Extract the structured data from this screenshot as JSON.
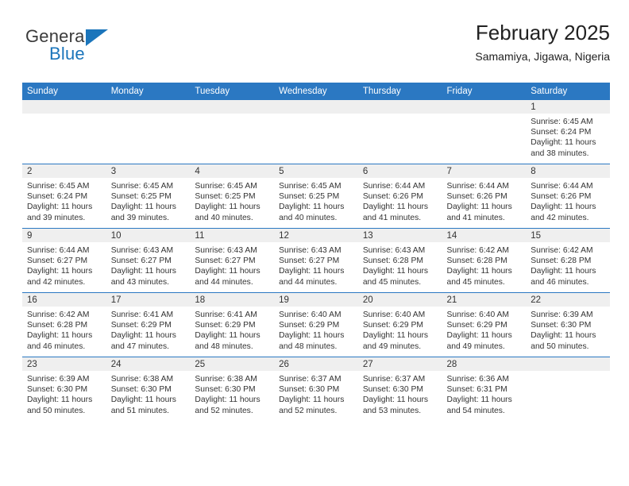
{
  "brand": {
    "name_top": "General",
    "name_bottom": "Blue",
    "accent_color": "#1b75bb"
  },
  "header": {
    "title": "February 2025",
    "subtitle": "Samamiya, Jigawa, Nigeria"
  },
  "theme": {
    "header_blue": "#2b78c2",
    "daynum_band": "#efefef",
    "text": "#333333"
  },
  "calendar": {
    "weekday_headers": [
      "Sunday",
      "Monday",
      "Tuesday",
      "Wednesday",
      "Thursday",
      "Friday",
      "Saturday"
    ],
    "labels": {
      "sunrise": "Sunrise:",
      "sunset": "Sunset:",
      "daylight": "Daylight:"
    },
    "weeks": [
      [
        {
          "day": "",
          "empty": true
        },
        {
          "day": "",
          "empty": true
        },
        {
          "day": "",
          "empty": true
        },
        {
          "day": "",
          "empty": true
        },
        {
          "day": "",
          "empty": true
        },
        {
          "day": "",
          "empty": true
        },
        {
          "day": "1",
          "sunrise": "Sunrise: 6:45 AM",
          "sunset": "Sunset: 6:24 PM",
          "daylight": "Daylight: 11 hours and 38 minutes."
        }
      ],
      [
        {
          "day": "2",
          "sunrise": "Sunrise: 6:45 AM",
          "sunset": "Sunset: 6:24 PM",
          "daylight": "Daylight: 11 hours and 39 minutes."
        },
        {
          "day": "3",
          "sunrise": "Sunrise: 6:45 AM",
          "sunset": "Sunset: 6:25 PM",
          "daylight": "Daylight: 11 hours and 39 minutes."
        },
        {
          "day": "4",
          "sunrise": "Sunrise: 6:45 AM",
          "sunset": "Sunset: 6:25 PM",
          "daylight": "Daylight: 11 hours and 40 minutes."
        },
        {
          "day": "5",
          "sunrise": "Sunrise: 6:45 AM",
          "sunset": "Sunset: 6:25 PM",
          "daylight": "Daylight: 11 hours and 40 minutes."
        },
        {
          "day": "6",
          "sunrise": "Sunrise: 6:44 AM",
          "sunset": "Sunset: 6:26 PM",
          "daylight": "Daylight: 11 hours and 41 minutes."
        },
        {
          "day": "7",
          "sunrise": "Sunrise: 6:44 AM",
          "sunset": "Sunset: 6:26 PM",
          "daylight": "Daylight: 11 hours and 41 minutes."
        },
        {
          "day": "8",
          "sunrise": "Sunrise: 6:44 AM",
          "sunset": "Sunset: 6:26 PM",
          "daylight": "Daylight: 11 hours and 42 minutes."
        }
      ],
      [
        {
          "day": "9",
          "sunrise": "Sunrise: 6:44 AM",
          "sunset": "Sunset: 6:27 PM",
          "daylight": "Daylight: 11 hours and 42 minutes."
        },
        {
          "day": "10",
          "sunrise": "Sunrise: 6:43 AM",
          "sunset": "Sunset: 6:27 PM",
          "daylight": "Daylight: 11 hours and 43 minutes."
        },
        {
          "day": "11",
          "sunrise": "Sunrise: 6:43 AM",
          "sunset": "Sunset: 6:27 PM",
          "daylight": "Daylight: 11 hours and 44 minutes."
        },
        {
          "day": "12",
          "sunrise": "Sunrise: 6:43 AM",
          "sunset": "Sunset: 6:27 PM",
          "daylight": "Daylight: 11 hours and 44 minutes."
        },
        {
          "day": "13",
          "sunrise": "Sunrise: 6:43 AM",
          "sunset": "Sunset: 6:28 PM",
          "daylight": "Daylight: 11 hours and 45 minutes."
        },
        {
          "day": "14",
          "sunrise": "Sunrise: 6:42 AM",
          "sunset": "Sunset: 6:28 PM",
          "daylight": "Daylight: 11 hours and 45 minutes."
        },
        {
          "day": "15",
          "sunrise": "Sunrise: 6:42 AM",
          "sunset": "Sunset: 6:28 PM",
          "daylight": "Daylight: 11 hours and 46 minutes."
        }
      ],
      [
        {
          "day": "16",
          "sunrise": "Sunrise: 6:42 AM",
          "sunset": "Sunset: 6:28 PM",
          "daylight": "Daylight: 11 hours and 46 minutes."
        },
        {
          "day": "17",
          "sunrise": "Sunrise: 6:41 AM",
          "sunset": "Sunset: 6:29 PM",
          "daylight": "Daylight: 11 hours and 47 minutes."
        },
        {
          "day": "18",
          "sunrise": "Sunrise: 6:41 AM",
          "sunset": "Sunset: 6:29 PM",
          "daylight": "Daylight: 11 hours and 48 minutes."
        },
        {
          "day": "19",
          "sunrise": "Sunrise: 6:40 AM",
          "sunset": "Sunset: 6:29 PM",
          "daylight": "Daylight: 11 hours and 48 minutes."
        },
        {
          "day": "20",
          "sunrise": "Sunrise: 6:40 AM",
          "sunset": "Sunset: 6:29 PM",
          "daylight": "Daylight: 11 hours and 49 minutes."
        },
        {
          "day": "21",
          "sunrise": "Sunrise: 6:40 AM",
          "sunset": "Sunset: 6:29 PM",
          "daylight": "Daylight: 11 hours and 49 minutes."
        },
        {
          "day": "22",
          "sunrise": "Sunrise: 6:39 AM",
          "sunset": "Sunset: 6:30 PM",
          "daylight": "Daylight: 11 hours and 50 minutes."
        }
      ],
      [
        {
          "day": "23",
          "sunrise": "Sunrise: 6:39 AM",
          "sunset": "Sunset: 6:30 PM",
          "daylight": "Daylight: 11 hours and 50 minutes."
        },
        {
          "day": "24",
          "sunrise": "Sunrise: 6:38 AM",
          "sunset": "Sunset: 6:30 PM",
          "daylight": "Daylight: 11 hours and 51 minutes."
        },
        {
          "day": "25",
          "sunrise": "Sunrise: 6:38 AM",
          "sunset": "Sunset: 6:30 PM",
          "daylight": "Daylight: 11 hours and 52 minutes."
        },
        {
          "day": "26",
          "sunrise": "Sunrise: 6:37 AM",
          "sunset": "Sunset: 6:30 PM",
          "daylight": "Daylight: 11 hours and 52 minutes."
        },
        {
          "day": "27",
          "sunrise": "Sunrise: 6:37 AM",
          "sunset": "Sunset: 6:30 PM",
          "daylight": "Daylight: 11 hours and 53 minutes."
        },
        {
          "day": "28",
          "sunrise": "Sunrise: 6:36 AM",
          "sunset": "Sunset: 6:31 PM",
          "daylight": "Daylight: 11 hours and 54 minutes."
        },
        {
          "day": "",
          "empty": true
        }
      ]
    ]
  }
}
